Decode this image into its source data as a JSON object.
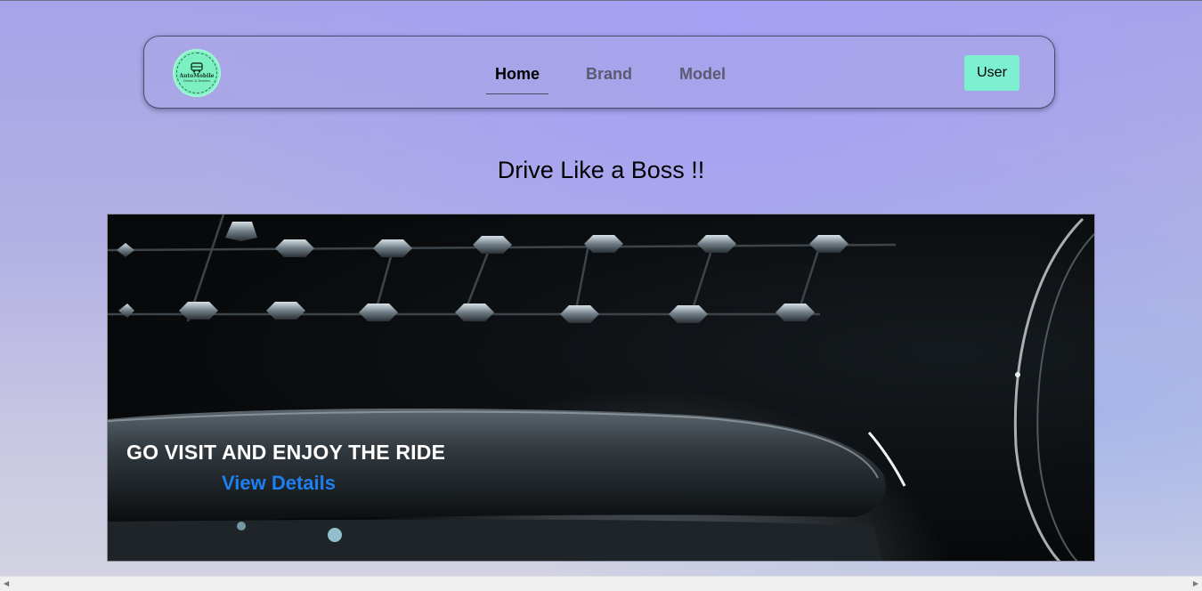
{
  "app": {
    "logo": {
      "title": "AutoMobile",
      "subtitle": "Driven & Dreams",
      "icon": "bus-icon",
      "color": "#7cf0c0"
    }
  },
  "nav": {
    "items": [
      {
        "label": "Home",
        "active": true
      },
      {
        "label": "Brand",
        "active": false
      },
      {
        "label": "Model",
        "active": false
      }
    ],
    "user_button": "User",
    "user_button_color": "#7cf0d0"
  },
  "main": {
    "headline": "Drive Like a Boss !!"
  },
  "hero": {
    "caption": "GO VISIT AND ENJOY THE RIDE",
    "link": "View Details",
    "link_color": "#1e7ff0"
  },
  "scrollbar": {
    "left_arrow": "◀",
    "right_arrow": "▶"
  }
}
